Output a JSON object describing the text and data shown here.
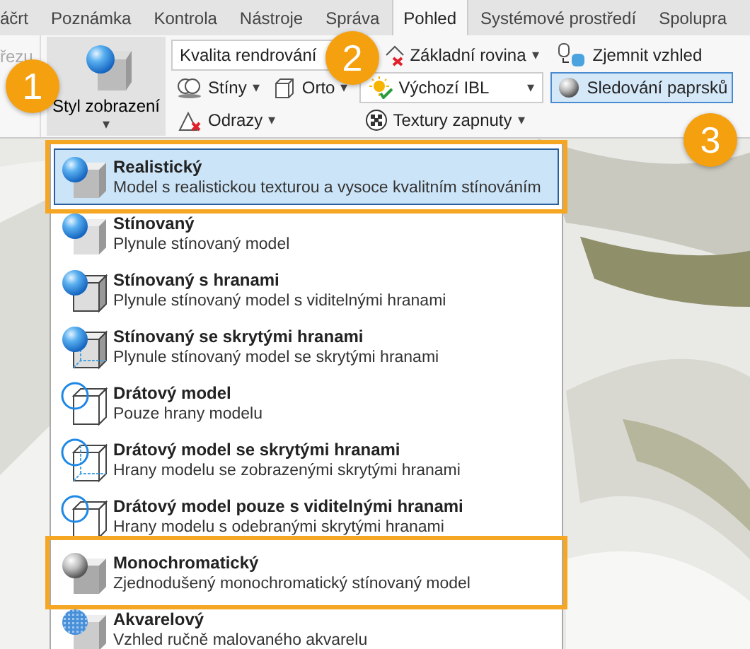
{
  "tabs": [
    {
      "label": "áčrt",
      "selected": false
    },
    {
      "label": "Poznámka",
      "selected": false
    },
    {
      "label": "Kontrola",
      "selected": false
    },
    {
      "label": "Nástroje",
      "selected": false
    },
    {
      "label": "Správa",
      "selected": false
    },
    {
      "label": "Pohled",
      "selected": true
    },
    {
      "label": "Systémové prostředí",
      "selected": false
    },
    {
      "label": "Spolupra",
      "selected": false
    }
  ],
  "ribbon": {
    "left_fragments": [
      "řezu"
    ],
    "display_style": {
      "label": "Styl zobrazení",
      "caret": "▾",
      "pressed": true
    },
    "render_quality": {
      "value": "Kvalita rendrování"
    },
    "shadows": {
      "label": "Stíny",
      "caret": "▾"
    },
    "ortho": {
      "label": "Orto",
      "caret": "▾"
    },
    "reflections": {
      "label": "Odrazy",
      "caret": "▾"
    },
    "ground_plane": {
      "label": "Základní rovina",
      "caret": "▾"
    },
    "ibl": {
      "value": "Výchozí IBL",
      "caret": "▾"
    },
    "textures": {
      "label": "Textury zapnuty",
      "caret": "▾"
    },
    "refine": {
      "label": "Zjemnit vzhled"
    },
    "ray_tracing": {
      "label": "Sledování paprsků",
      "selected": true
    }
  },
  "callouts": [
    "1",
    "2",
    "3"
  ],
  "menu": {
    "items": [
      {
        "kind": "realistic",
        "title": "Realistický",
        "description": "Model s realistickou texturou a vysoce kvalitním stínováním",
        "selected": true,
        "highlighted": true
      },
      {
        "kind": "shaded",
        "title": "Stínovaný",
        "description": "Plynule stínovaný model",
        "selected": false,
        "highlighted": false
      },
      {
        "kind": "shaded-edges",
        "title": "Stínovaný s hranami",
        "description": "Plynule stínovaný model s viditelnými hranami",
        "selected": false,
        "highlighted": false
      },
      {
        "kind": "shaded-hidden",
        "title": "Stínovaný se skrytými hranami",
        "description": "Plynule stínovaný model se skrytými hranami",
        "selected": false,
        "highlighted": false
      },
      {
        "kind": "wireframe",
        "title": "Drátový model",
        "description": "Pouze hrany modelu",
        "selected": false,
        "highlighted": false
      },
      {
        "kind": "wireframe-hidden",
        "title": "Drátový model se skrytými hranami",
        "description": "Hrany modelu se zobrazenými skrytými hranami",
        "selected": false,
        "highlighted": false
      },
      {
        "kind": "wireframe-visible",
        "title": "Drátový model pouze s viditelnými hranami",
        "description": "Hrany modelu s odebranými skrytými hranami",
        "selected": false,
        "highlighted": false
      },
      {
        "kind": "monochrome",
        "title": "Monochromatický",
        "description": "Zjednodušený monochromatický stínovaný model",
        "selected": false,
        "highlighted": true
      },
      {
        "kind": "watercolor",
        "title": "Akvarelový",
        "description": "Vzhled ručně malovaného akvarelu",
        "selected": false,
        "highlighted": false
      }
    ]
  }
}
